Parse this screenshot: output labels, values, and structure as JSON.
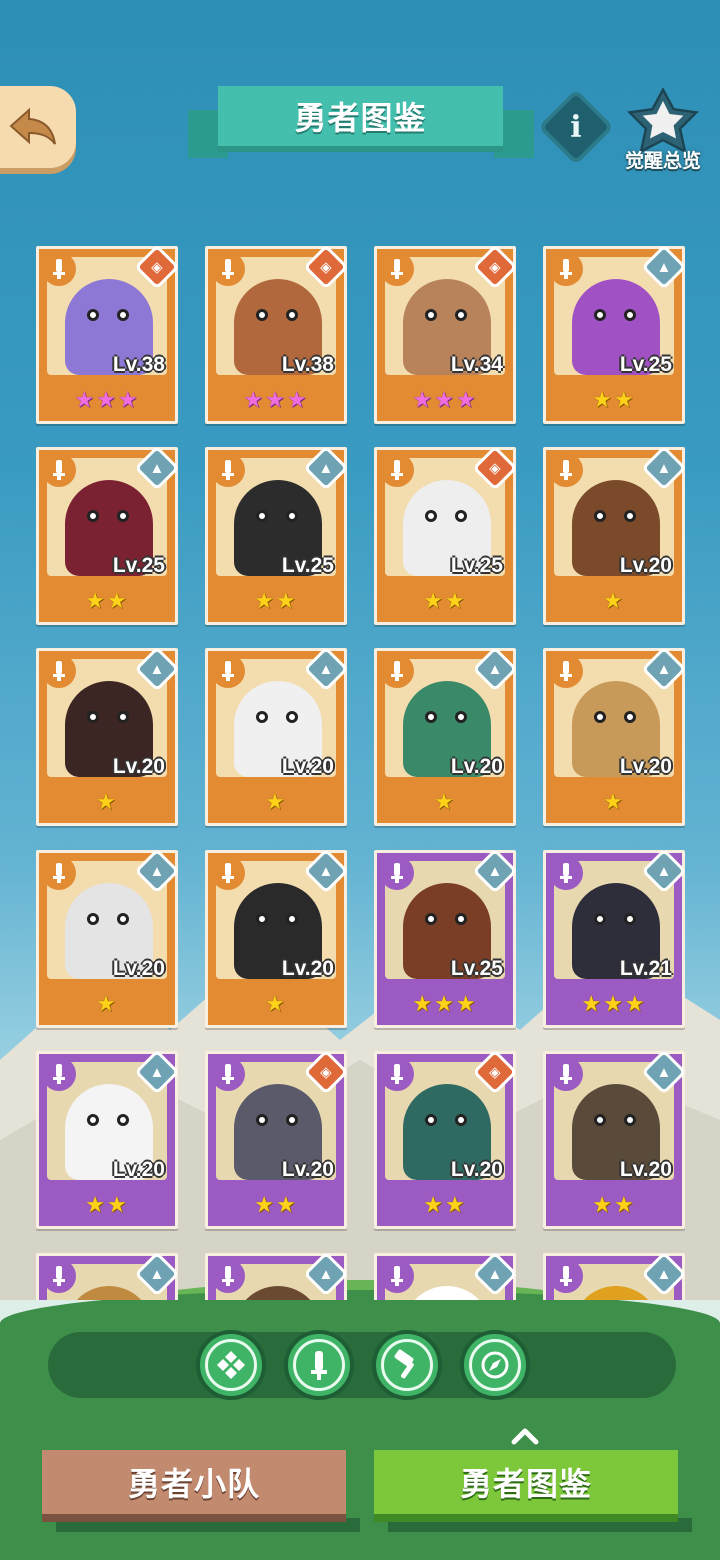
{
  "header": {
    "title": "勇者图鉴",
    "info_label": "i",
    "awaken_label": "觉醒总览"
  },
  "heroes": [
    {
      "level": "Lv.38",
      "stars": "★★★",
      "star_color": "pink",
      "rarity": "orange",
      "weapon": "special",
      "color": "#8d78d6"
    },
    {
      "level": "Lv.38",
      "stars": "★★★",
      "star_color": "pink",
      "rarity": "orange",
      "weapon": "special",
      "color": "#b0683c"
    },
    {
      "level": "Lv.34",
      "stars": "★★★",
      "star_color": "pink",
      "rarity": "orange",
      "weapon": "special",
      "color": "#b8825a"
    },
    {
      "level": "Lv.25",
      "stars": "★★",
      "star_color": "gold",
      "rarity": "orange",
      "weapon": "hammer",
      "color": "#a052c4"
    },
    {
      "level": "Lv.25",
      "stars": "★★",
      "star_color": "gold",
      "rarity": "orange",
      "weapon": "hammer",
      "color": "#7a2232"
    },
    {
      "level": "Lv.25",
      "stars": "★★",
      "star_color": "gold",
      "rarity": "orange",
      "weapon": "hammer",
      "color": "#2c2c2c"
    },
    {
      "level": "Lv.25",
      "stars": "★★",
      "star_color": "gold",
      "rarity": "orange",
      "weapon": "special",
      "color": "#eeeeee"
    },
    {
      "level": "Lv.20",
      "stars": "★",
      "star_color": "gold",
      "rarity": "orange",
      "weapon": "hammer",
      "color": "#7a4a2a"
    },
    {
      "level": "Lv.20",
      "stars": "★",
      "star_color": "gold",
      "rarity": "orange",
      "weapon": "hammer",
      "color": "#3b2624"
    },
    {
      "level": "Lv.20",
      "stars": "★",
      "star_color": "gold",
      "rarity": "orange",
      "weapon": "hammer",
      "color": "#f0f0f0"
    },
    {
      "level": "Lv.20",
      "stars": "★",
      "star_color": "gold",
      "rarity": "orange",
      "weapon": "hammer",
      "color": "#3a8a6a"
    },
    {
      "level": "Lv.20",
      "stars": "★",
      "star_color": "gold",
      "rarity": "orange",
      "weapon": "hammer",
      "color": "#c89a5a"
    },
    {
      "level": "Lv.20",
      "stars": "★",
      "star_color": "gold",
      "rarity": "orange",
      "weapon": "hammer",
      "color": "#e4e4e4"
    },
    {
      "level": "Lv.20",
      "stars": "★",
      "star_color": "gold",
      "rarity": "orange",
      "weapon": "hammer",
      "color": "#2a2a2a"
    },
    {
      "level": "Lv.25",
      "stars": "★★★",
      "star_color": "gold",
      "rarity": "purple",
      "weapon": "hammer",
      "color": "#7a3e26"
    },
    {
      "level": "Lv.21",
      "stars": "★★★",
      "star_color": "gold",
      "rarity": "purple",
      "weapon": "hammer",
      "color": "#2e2e3a"
    },
    {
      "level": "Lv.20",
      "stars": "★★",
      "star_color": "gold",
      "rarity": "purple",
      "weapon": "hammer",
      "color": "#f4f4f4"
    },
    {
      "level": "Lv.20",
      "stars": "★★",
      "star_color": "gold",
      "rarity": "purple",
      "weapon": "special",
      "color": "#5a5a6a"
    },
    {
      "level": "Lv.20",
      "stars": "★★",
      "star_color": "gold",
      "rarity": "purple",
      "weapon": "special",
      "color": "#2f6a62"
    },
    {
      "level": "Lv.20",
      "stars": "★★",
      "star_color": "gold",
      "rarity": "purple",
      "weapon": "hammer",
      "color": "#5a4a3a"
    },
    {
      "level": "",
      "stars": "",
      "star_color": "gold",
      "rarity": "purple",
      "weapon": "hammer",
      "color": "#c08a40"
    },
    {
      "level": "",
      "stars": "",
      "star_color": "gold",
      "rarity": "purple",
      "weapon": "hammer",
      "color": "#6a4a30"
    },
    {
      "level": "",
      "stars": "",
      "star_color": "gold",
      "rarity": "purple",
      "weapon": "hammer",
      "color": "#ffffff"
    },
    {
      "level": "",
      "stars": "",
      "star_color": "gold",
      "rarity": "purple",
      "weapon": "hammer",
      "color": "#e0a020"
    }
  ],
  "filters": [
    "all-classes-icon",
    "sword-class-icon",
    "hammer-class-icon",
    "compass-class-icon"
  ],
  "tabs": {
    "team": "勇者小队",
    "codex": "勇者图鉴"
  },
  "colors": {
    "card_orange": "#e28b33",
    "card_purple": "#9c5bc2",
    "title_ribbon": "#44bfae",
    "tab_active": "#7cc73a",
    "tab_inactive": "#c28b70"
  }
}
